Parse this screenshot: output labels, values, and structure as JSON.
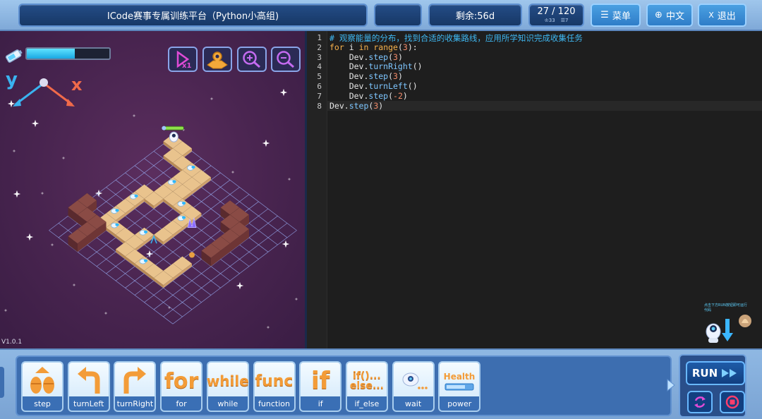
{
  "header": {
    "title": "ICode赛事专属训练平台（Python小高组)",
    "remaining": "剩余:56d",
    "progress": {
      "current": "27 / 120",
      "stat_a": "33",
      "stat_b": "7"
    },
    "menu_label": "菜单",
    "lang_label": "中文",
    "exit_label": "退出"
  },
  "game": {
    "energy_level": 0.58,
    "axis_y": "y",
    "axis_x": "x",
    "version": "V1.0.1",
    "tools": [
      "speed-icon",
      "map-icon",
      "zoom-in-icon",
      "zoom-out-icon"
    ]
  },
  "editor": {
    "line_numbers": [
      "1",
      "2",
      "3",
      "4",
      "5",
      "6",
      "7",
      "8"
    ],
    "lines": [
      [
        {
          "t": "# 观察能量的分布，找到合适的收集路线，应用所学知识完成收集任务",
          "c": "cm"
        }
      ],
      [
        {
          "t": "for",
          "c": "kw"
        },
        {
          "t": " i ",
          "c": "name"
        },
        {
          "t": "in",
          "c": "kw"
        },
        {
          "t": " ",
          "c": "name"
        },
        {
          "t": "range",
          "c": "kw"
        },
        {
          "t": "(",
          "c": "op"
        },
        {
          "t": "3",
          "c": "num"
        },
        {
          "t": "):",
          "c": "op"
        }
      ],
      [
        {
          "t": "    Dev.",
          "c": "name"
        },
        {
          "t": "step",
          "c": "fn"
        },
        {
          "t": "(",
          "c": "op"
        },
        {
          "t": "3",
          "c": "num"
        },
        {
          "t": ")",
          "c": "op"
        }
      ],
      [
        {
          "t": "    Dev.",
          "c": "name"
        },
        {
          "t": "turnRight",
          "c": "fn"
        },
        {
          "t": "()",
          "c": "op"
        }
      ],
      [
        {
          "t": "    Dev.",
          "c": "name"
        },
        {
          "t": "step",
          "c": "fn"
        },
        {
          "t": "(",
          "c": "op"
        },
        {
          "t": "3",
          "c": "num"
        },
        {
          "t": ")",
          "c": "op"
        }
      ],
      [
        {
          "t": "    Dev.",
          "c": "name"
        },
        {
          "t": "turnLeft",
          "c": "fn"
        },
        {
          "t": "()",
          "c": "op"
        }
      ],
      [
        {
          "t": "    Dev.",
          "c": "name"
        },
        {
          "t": "step",
          "c": "fn"
        },
        {
          "t": "(",
          "c": "op"
        },
        {
          "t": "-2",
          "c": "num"
        },
        {
          "t": ")",
          "c": "op"
        }
      ],
      [
        {
          "t": "Dev.",
          "c": "name"
        },
        {
          "t": "step",
          "c": "fn"
        },
        {
          "t": "(",
          "c": "op"
        },
        {
          "t": "3",
          "c": "num"
        },
        {
          "t": ")",
          "c": "op"
        }
      ]
    ]
  },
  "commands": [
    {
      "label": "step",
      "icon": "step-icon"
    },
    {
      "label": "turnLeft",
      "icon": "turn-left-icon"
    },
    {
      "label": "turnRight",
      "icon": "turn-right-icon"
    },
    {
      "label": "for",
      "icon": "for-icon",
      "word": "for"
    },
    {
      "label": "while",
      "icon": "while-icon",
      "word": "while"
    },
    {
      "label": "function",
      "icon": "func-icon",
      "word": "func"
    },
    {
      "label": "if",
      "icon": "if-icon",
      "word": "if"
    },
    {
      "label": "if_else",
      "icon": "if-else-icon",
      "word": "if()...",
      "word2": "else..."
    },
    {
      "label": "wait",
      "icon": "wait-icon"
    },
    {
      "label": "power",
      "icon": "power-icon",
      "word": "Health"
    }
  ],
  "run": {
    "label": "RUN"
  },
  "hint": {
    "text": "点击下方RUN按钮即可运行代码"
  },
  "colors": {
    "accent": "#2f7dc8",
    "game_bg": "#48244f",
    "tile": "#e9c38d",
    "wall": "#8a4b45"
  }
}
